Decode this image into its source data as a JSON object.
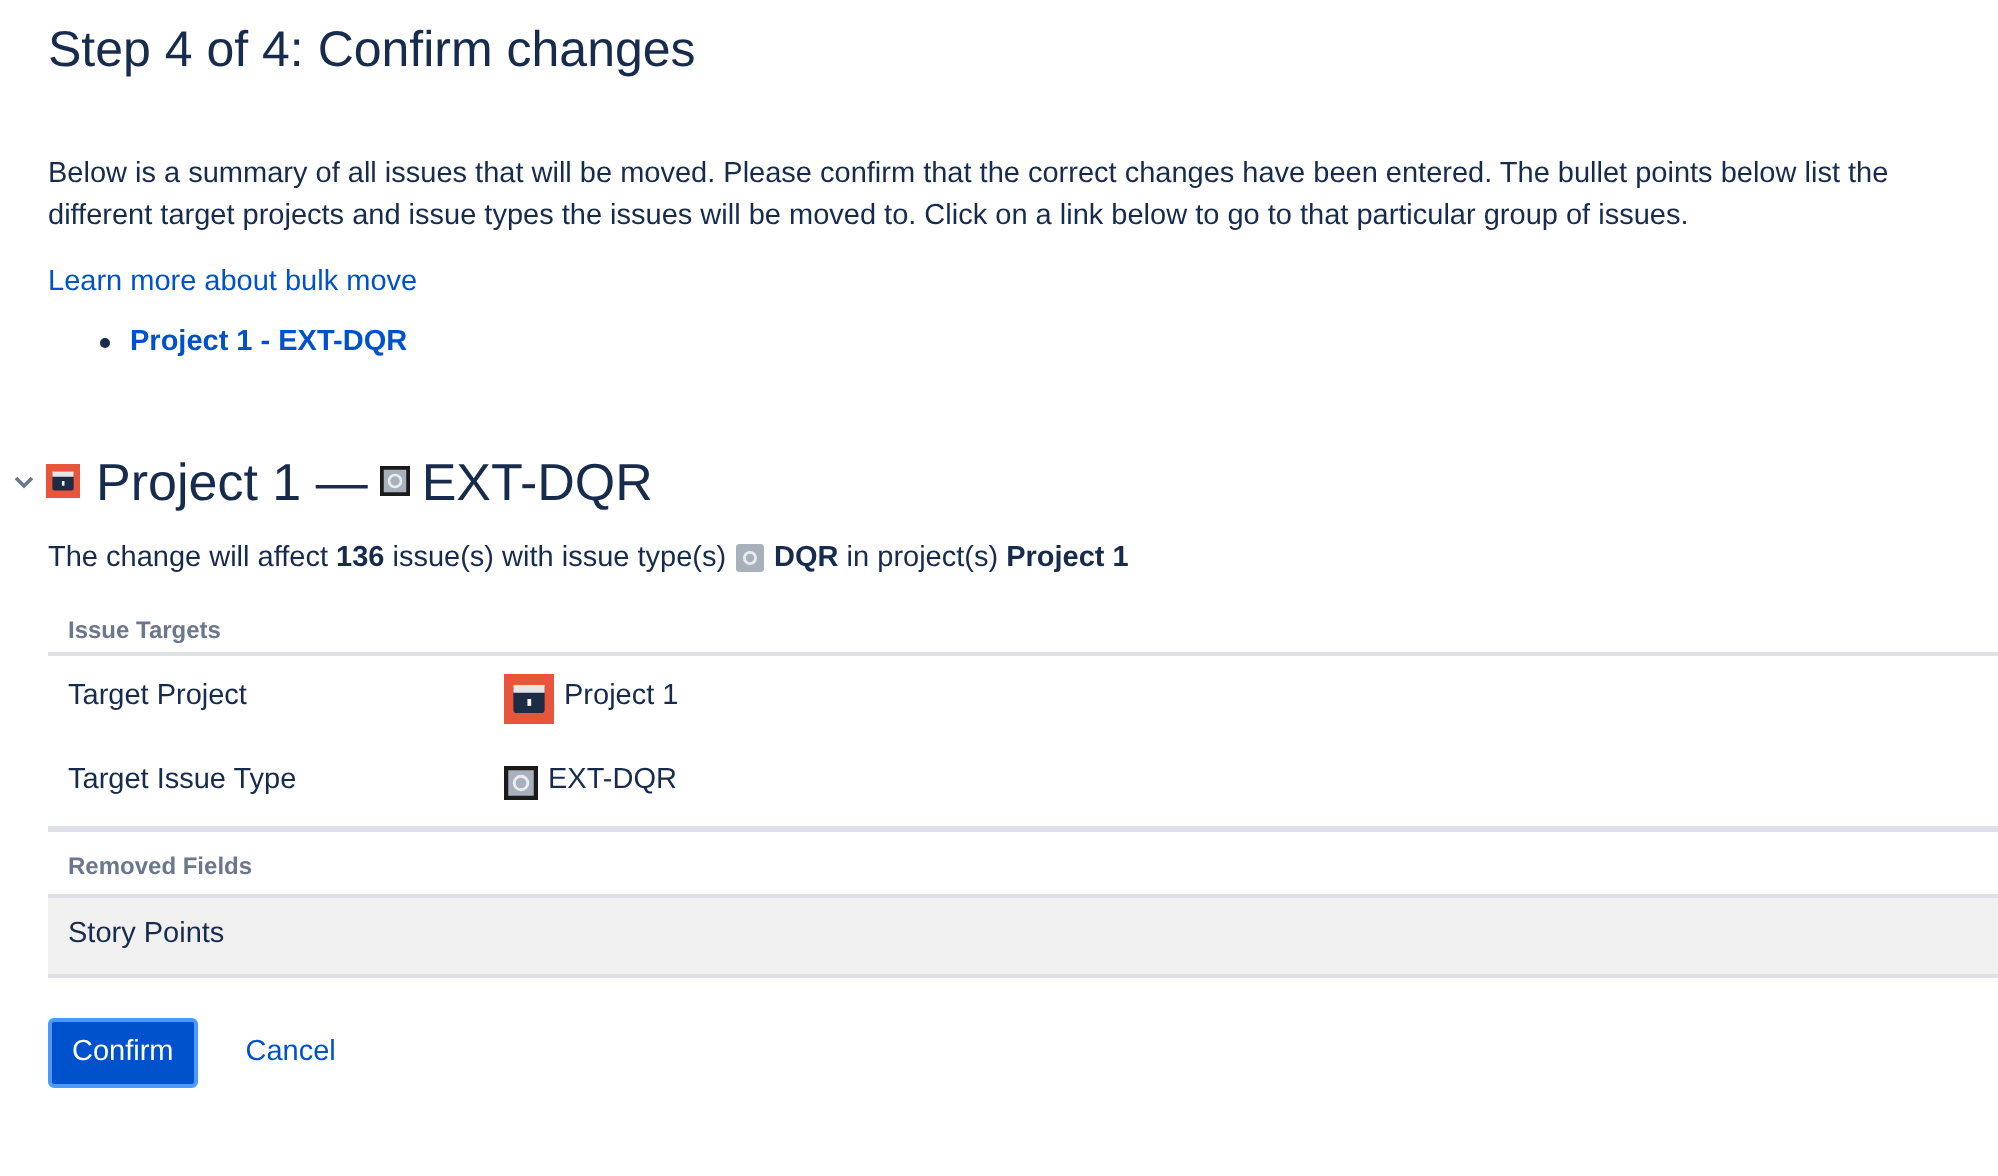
{
  "title": "Step 4 of 4: Confirm changes",
  "description": "Below is a summary of all issues that will be moved. Please confirm that the correct changes have been entered. The bullet points below list the different target projects and issue types the issues will be moved to. Click on a link below to go to that particular group of issues.",
  "learn_more_link": "Learn more about bulk move",
  "group_links": [
    "Project 1 - EXT-DQR"
  ],
  "section": {
    "expanded": true,
    "project": "Project 1 —",
    "issue_type": "EXT-DQR",
    "summary_before": "The change will affect **136** issue(s) with issue type(s)",
    "summary_after": "**DQR** in project(s) **Project 1**",
    "targets_heading": "Issue Targets",
    "targets": [
      {
        "label": "Target Project",
        "value": "Project 1",
        "kind": "project"
      },
      {
        "label": "Target Issue Type",
        "value": "EXT-DQR",
        "kind": "issuetype"
      }
    ],
    "removed_heading": "Removed Fields",
    "removed": [
      "Story Points"
    ]
  },
  "buttons": {
    "confirm": "Confirm",
    "cancel": "Cancel"
  }
}
